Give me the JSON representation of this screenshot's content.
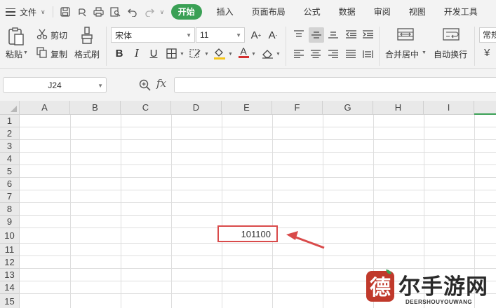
{
  "menubar": {
    "file_label": "文件",
    "tabs": [
      {
        "label": "开始",
        "active": true
      },
      {
        "label": "插入"
      },
      {
        "label": "页面布局"
      },
      {
        "label": "公式"
      },
      {
        "label": "数据"
      },
      {
        "label": "审阅"
      },
      {
        "label": "视图"
      },
      {
        "label": "开发工具"
      }
    ]
  },
  "ribbon": {
    "paste_label": "粘贴",
    "cut_label": "剪切",
    "copy_label": "复制",
    "format_painter_label": "格式刷",
    "font_name": "宋体",
    "font_size": "11",
    "merge_label": "合并居中",
    "wrap_label": "自动换行",
    "number_format_partial": "常规",
    "currency_symbol": "¥"
  },
  "formula_bar": {
    "name_box": "J24",
    "fx_label": "fx",
    "formula": ""
  },
  "grid": {
    "columns": [
      "A",
      "B",
      "C",
      "D",
      "E",
      "F",
      "G",
      "H",
      "I"
    ],
    "rows": [
      "1",
      "2",
      "3",
      "4",
      "5",
      "6",
      "7",
      "8",
      "9",
      "10",
      "11",
      "12",
      "13",
      "14",
      "15"
    ],
    "highlighted_cell": {
      "ref": "E10",
      "value": "101100"
    }
  },
  "colors": {
    "accent_green": "#3aa055",
    "highlight_red": "#d94a4a"
  },
  "watermark": {
    "seal_char": "德",
    "title": "尔手游网",
    "subtitle": "DEERSHOUYOUWANG"
  }
}
